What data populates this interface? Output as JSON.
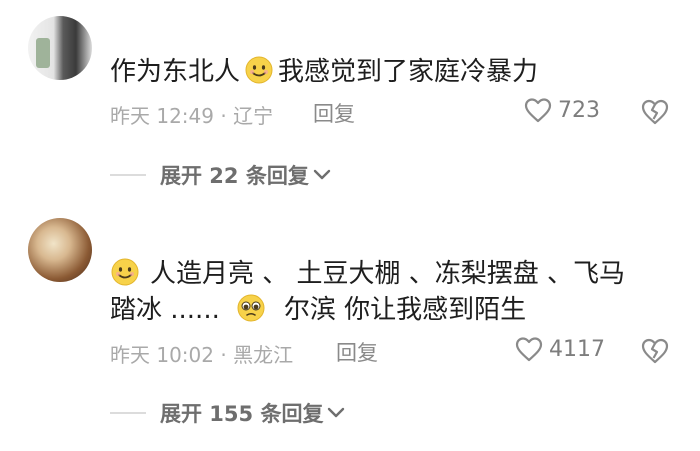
{
  "comments": [
    {
      "text_before": "作为东北人",
      "emoji": "smiling-face-emoji",
      "text_after": "我感觉到了家庭冷暴力",
      "time_location": "昨天 12:49 · 辽宁",
      "reply_label": "回复",
      "like_count": "723",
      "expand_label": "展开 22 条回复"
    },
    {
      "line1": "人造月亮 、 土豆大棚 、冻梨摆盘 、飞马",
      "line2_before": "踏冰 ......",
      "line2_emoji": "pleading-face-emoji",
      "line2_after": "尔滨 你让我感到陌生",
      "emoji": "smiling-face-emoji",
      "time_location": "昨天 10:02 · 黑龙江",
      "reply_label": "回复",
      "like_count": "4117",
      "expand_label": "展开 155 条回复"
    }
  ],
  "colors": {
    "emoji_face": "#f7d24a",
    "meta": "#a9a9a9",
    "icon": "#8a8a8a"
  }
}
